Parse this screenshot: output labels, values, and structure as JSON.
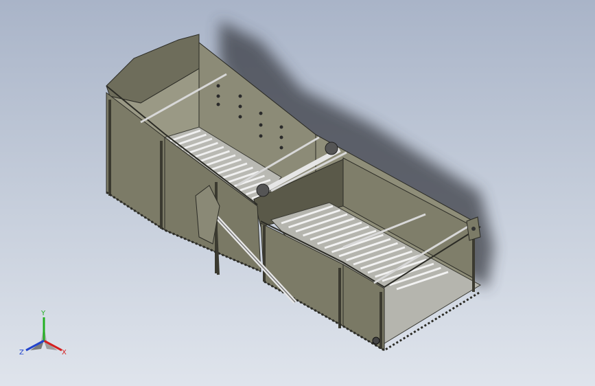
{
  "triad": {
    "x_label": "X",
    "y_label": "Y",
    "z_label": "Z"
  },
  "colors": {
    "background_top": "#a9b4c8",
    "background_bottom": "#dfe4ec",
    "body_fill": "#7c7b67",
    "body_dark": "#5f5e4e",
    "body_light": "#9c9b86",
    "roller": "#c9c9c9",
    "axis_x": "#d42020",
    "axis_y": "#22b022",
    "axis_z": "#2244cc"
  }
}
